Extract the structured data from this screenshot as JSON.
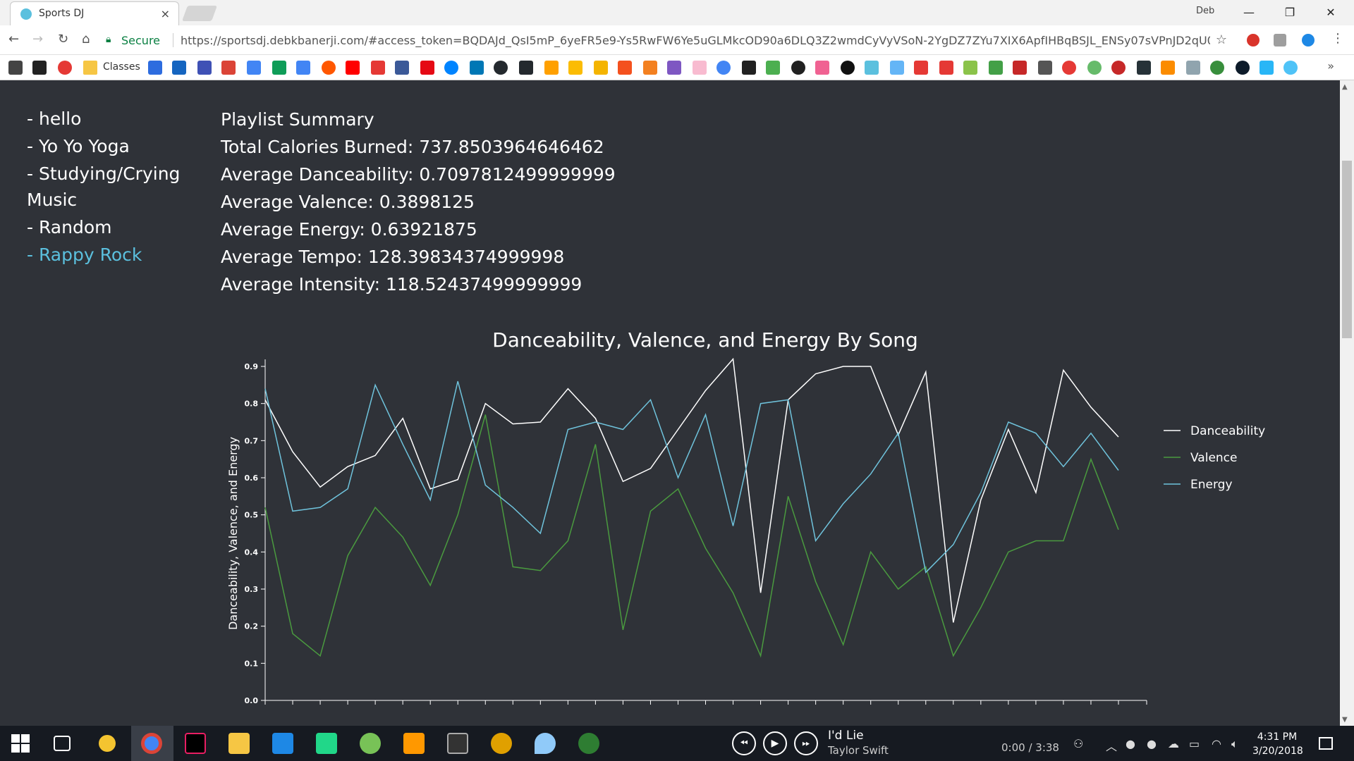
{
  "browser": {
    "tab_title": "Sports DJ",
    "tab_close": "×",
    "profile": "Deb",
    "window_controls": [
      "—",
      "❐",
      "✕"
    ],
    "secure_label": "Secure",
    "url": "https://sportsdj.debkbanerji.com/#access_token=BQDAJd_QsI5mP_6yeFR5e9-Ys5RwFW6Ye5uGLMkcOD90a6DLQ3Z2wmdCyVyVSoN-2YgDZ7ZYu7XIX6ApfIHBqBSJL_ENSy07sVPnJD2qU0Kf...",
    "bookmarks_label": "Classes",
    "bookmarks_more": "»"
  },
  "sidebar": {
    "playlists": [
      {
        "label": "- hello"
      },
      {
        "label": "- Yo Yo Yoga"
      },
      {
        "label": "- Studying/Crying Music"
      },
      {
        "label": "- Random"
      },
      {
        "label": "- Rappy Rock",
        "active": true
      }
    ]
  },
  "summary": {
    "heading": "Playlist Summary",
    "total_calories": "Total Calories Burned: 737.8503964646462",
    "avg_danceability": "Average Danceability: 0.7097812499999999",
    "avg_valence": "Average Valence: 0.3898125",
    "avg_energy": "Average Energy: 0.63921875",
    "avg_tempo": "Average Tempo: 128.39834374999998",
    "avg_intensity": "Average Intensity: 118.52437499999999"
  },
  "chart_data": {
    "type": "line",
    "title": "Danceability, Valence, and Energy By Song",
    "xlabel": "",
    "ylabel": "Danceability, Valence, and Energy",
    "ylim": [
      0,
      0.9
    ],
    "yticks": [
      "0.0",
      "0.1",
      "0.2",
      "0.3",
      "0.4",
      "0.5",
      "0.6",
      "0.7",
      "0.8",
      "0.9"
    ],
    "grid": false,
    "legend_position": "right",
    "series": [
      {
        "name": "Danceability",
        "color": "#ffffff",
        "values": [
          0.81,
          0.67,
          0.575,
          0.63,
          0.66,
          0.76,
          0.57,
          0.595,
          0.8,
          0.745,
          0.75,
          0.84,
          0.76,
          0.59,
          0.625,
          0.73,
          0.835,
          0.92,
          0.29,
          0.81,
          0.88,
          0.9,
          0.9,
          0.715,
          0.885,
          0.21,
          0.54,
          0.73,
          0.56,
          0.89,
          0.79,
          0.71
        ]
      },
      {
        "name": "Valence",
        "color": "#4a9a3f",
        "values": [
          0.52,
          0.18,
          0.12,
          0.39,
          0.52,
          0.44,
          0.31,
          0.5,
          0.77,
          0.36,
          0.35,
          0.43,
          0.69,
          0.19,
          0.51,
          0.57,
          0.41,
          0.29,
          0.12,
          0.55,
          0.32,
          0.15,
          0.4,
          0.3,
          0.36,
          0.12,
          0.25,
          0.4,
          0.43,
          0.43,
          0.65,
          0.46
        ]
      },
      {
        "name": "Energy",
        "color": "#6fc3dc",
        "values": [
          0.84,
          0.51,
          0.52,
          0.57,
          0.85,
          0.69,
          0.54,
          0.86,
          0.58,
          0.52,
          0.45,
          0.73,
          0.75,
          0.73,
          0.81,
          0.6,
          0.77,
          0.47,
          0.8,
          0.81,
          0.43,
          0.53,
          0.61,
          0.72,
          0.345,
          0.42,
          0.56,
          0.75,
          0.72,
          0.63,
          0.72,
          0.62
        ]
      }
    ]
  },
  "taskbar": {
    "song_title": "I'd Lie",
    "artist": "Taylor Swift",
    "time": "0:00 / 3:38",
    "clock_time": "4:31 PM",
    "clock_date": "3/20/2018"
  }
}
